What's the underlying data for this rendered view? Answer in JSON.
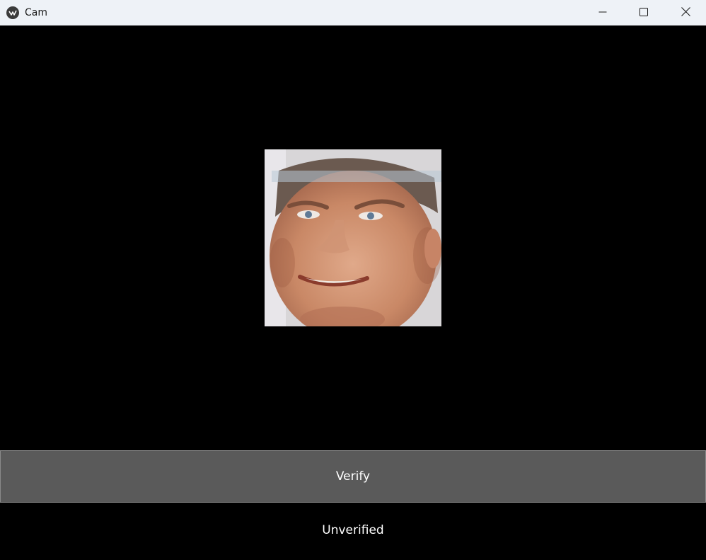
{
  "window": {
    "title": "Cam",
    "app_icon": "kivy-logo-icon",
    "controls": {
      "minimize_icon": "minimize-icon",
      "maximize_icon": "maximize-icon",
      "close_icon": "close-icon"
    }
  },
  "main": {
    "camera_feed": {
      "content": "webcam-face-image"
    },
    "verify_button": {
      "label": "Verify"
    },
    "status": {
      "text": "Unverified"
    }
  },
  "colors": {
    "titlebar_bg": "#eef2f7",
    "content_bg": "#000000",
    "button_bg": "#5a5a5a",
    "text": "#ffffff"
  }
}
